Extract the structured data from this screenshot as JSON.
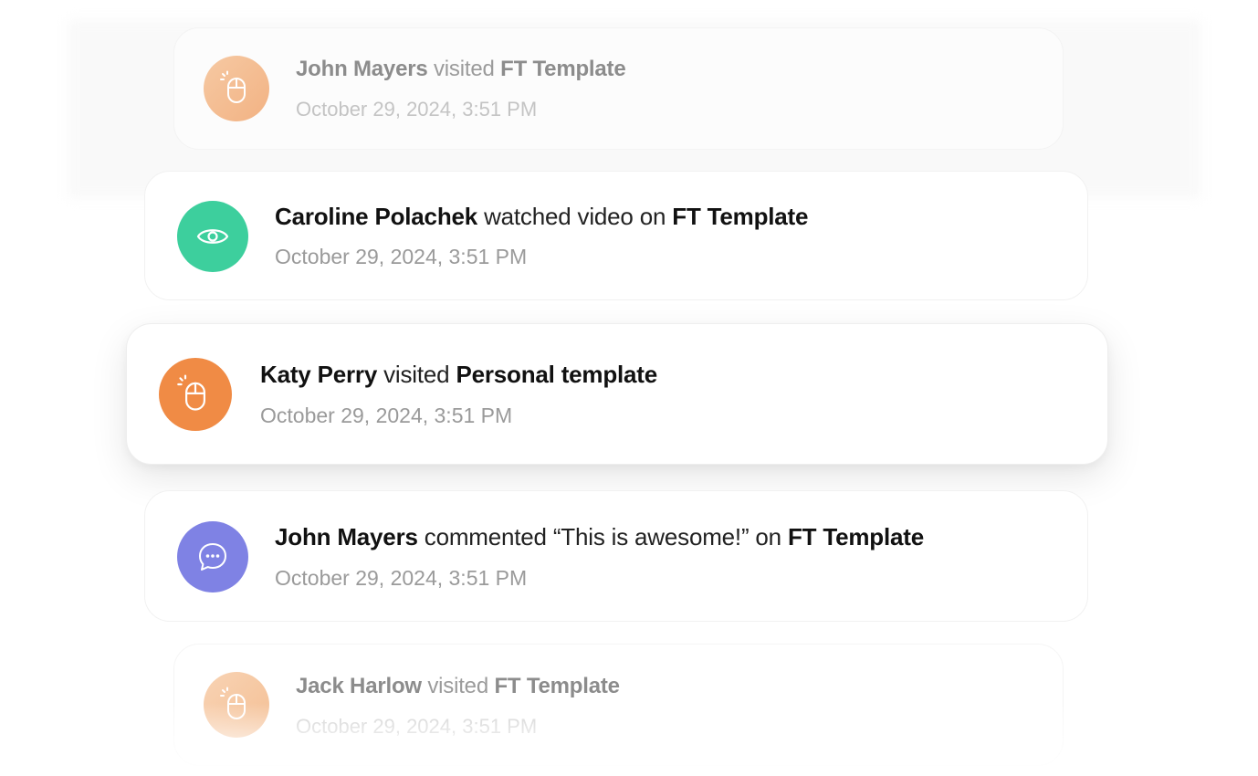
{
  "activity_feed": {
    "items": [
      {
        "icon": "mouse-click-icon",
        "icon_color": "#f4bc8f",
        "actor": "John Mayers",
        "action": "visited",
        "target": "FT Template",
        "timestamp": "October 29, 2024, 3:51 PM"
      },
      {
        "icon": "eye-icon",
        "icon_color": "#3dcf9d",
        "actor": "Caroline Polachek",
        "action": "watched video on",
        "target": "FT Template",
        "timestamp": "October 29, 2024, 3:51 PM"
      },
      {
        "icon": "mouse-click-icon",
        "icon_color": "#f08b45",
        "actor": "Katy Perry",
        "action": "visited",
        "target": "Personal template",
        "timestamp": "October 29, 2024, 3:51 PM"
      },
      {
        "icon": "chat-bubble-icon",
        "icon_color": "#7f82e4",
        "actor": "John Mayers",
        "action": "commented “This is awesome!” on",
        "target": "FT Template",
        "timestamp": "October 29, 2024, 3:51 PM"
      },
      {
        "icon": "mouse-click-icon",
        "icon_color": "#f6c9a3",
        "actor": "Jack Harlow",
        "action": "visited",
        "target": "FT Template",
        "timestamp": "October 29, 2024, 3:51 PM"
      }
    ]
  }
}
